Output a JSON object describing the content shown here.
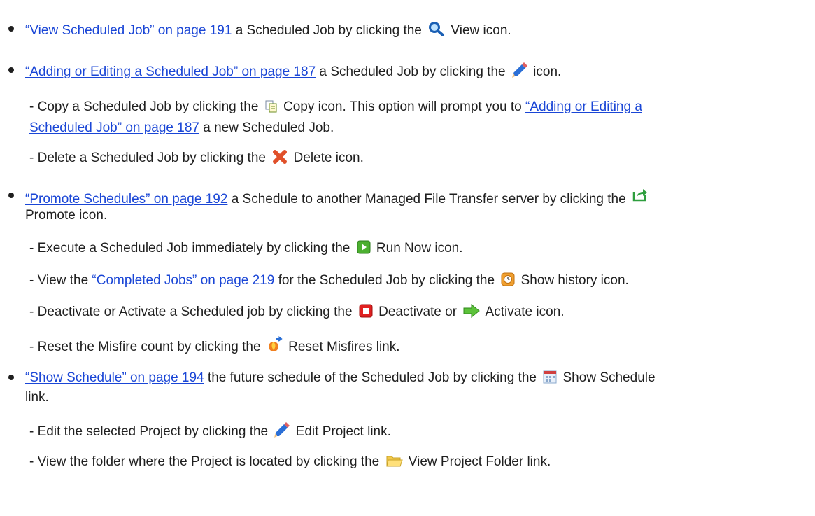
{
  "items": [
    {
      "link": "“View Scheduled Job” on page 191",
      "pre": " a Scheduled Job by clicking the ",
      "icon": "magnifier-icon",
      "post": " View icon."
    },
    {
      "link": "“Adding or Editing a Scheduled Job” on page 187",
      "pre": " a Scheduled Job by clicking the ",
      "icon": "pencil-icon",
      "post": " icon."
    },
    {
      "pre": "- Copy a Scheduled Job by clicking the ",
      "icon": "copy-icon",
      "post": " Copy icon. This option will prompt you to ",
      "link_a": "“Adding or Editing a",
      "link_b": "Scheduled Job” on page 187",
      "post2": " a new Scheduled Job."
    },
    {
      "pre": "- Delete a Scheduled Job by clicking the ",
      "icon": "delete-icon",
      "post": " Delete icon."
    },
    {
      "link": "“Promote Schedules” on page 192",
      "pre": " a Schedule to another Managed File Transfer server by clicking the ",
      "icon": "promote-icon",
      "post": "Promote icon."
    },
    {
      "pre": "- Execute a Scheduled Job immediately by clicking the ",
      "icon": "run-now-icon",
      "post": " Run Now icon."
    },
    {
      "pre": "- View the ",
      "link": "“Completed Jobs” on page 219",
      "mid": " for the Scheduled Job by clicking the ",
      "icon": "history-icon",
      "post": " Show history icon."
    },
    {
      "pre": "- Deactivate or Activate a Scheduled job by clicking the ",
      "icon": "deactivate-icon",
      "mid": " Deactivate or ",
      "icon2": "activate-icon",
      "post": " Activate icon."
    },
    {
      "pre": "- Reset the Misfire count by clicking the ",
      "icon": "reset-misfires-icon",
      "post": " Reset Misfires link."
    },
    {
      "link": "“Show Schedule” on page 194",
      "pre": " the future schedule of the Scheduled Job by clicking the ",
      "icon": "calendar-icon",
      "post": " Show Schedule",
      "post2": "link."
    },
    {
      "pre": "- Edit the selected Project by clicking the ",
      "icon": "pencil-icon",
      "post": " Edit Project link."
    },
    {
      "pre": "- View the folder where the Project is located by clicking the ",
      "icon": "folder-icon",
      "post": " View Project Folder link."
    }
  ],
  "colors": {
    "link": "#1a46d6",
    "text": "#1f1f1f"
  }
}
